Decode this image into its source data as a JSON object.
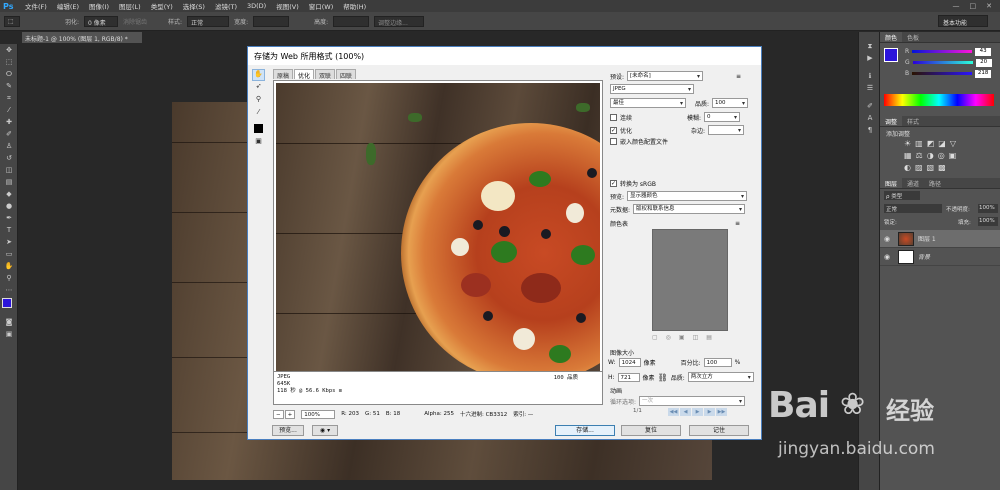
{
  "app": {
    "logo": "Ps",
    "menus": [
      "文件(F)",
      "编辑(E)",
      "图像(I)",
      "图层(L)",
      "类型(Y)",
      "选择(S)",
      "滤镜(T)",
      "3D(D)",
      "视图(V)",
      "窗口(W)",
      "帮助(H)"
    ],
    "window_controls": [
      "—",
      "□",
      "✕"
    ]
  },
  "options": {
    "feather_label": "羽化:",
    "feather_value": "0 像素",
    "antialias_label": "消除锯齿",
    "style_label": "样式:",
    "style_value": "正常",
    "width_label": "宽度:",
    "height_label": "高度:",
    "refine_edge": "调整边缘...",
    "workspace": "基本功能"
  },
  "document": {
    "tab": "未标题-1 @ 100% (图层 1, RGB/8) *"
  },
  "dialog": {
    "title": "存储为 Web 所用格式 (100%)",
    "tabs": [
      "原稿",
      "优化",
      "双联",
      "四联"
    ],
    "active_tab": "优化",
    "preview_info": {
      "format": "JPEG",
      "size": "645K",
      "time": "118 秒 @ 56.6 Kbps",
      "menu": "≡",
      "quality": "100 品质"
    },
    "status": {
      "zoom": "100%",
      "r": "R: 203",
      "g": "G: 51",
      "b": "B: 18",
      "alpha": "Alpha: 255",
      "hex": "十六进制: CB3312",
      "index": "索引: —"
    },
    "settings": {
      "preset_label": "预设:",
      "preset_value": "[未命名]",
      "format": "JPEG",
      "quality_level": "最佳",
      "quality_label": "品质:",
      "quality_value": "100",
      "progressive": "连续",
      "blur_label": "模糊:",
      "blur_value": "0",
      "optimized": "优化",
      "matte_label": "杂边:",
      "embed_profile": "嵌入颜色配置文件",
      "convert_srgb": "转换为 sRGB",
      "preview_label": "预览:",
      "preview_value": "显示器颜色",
      "metadata_label": "元数据:",
      "metadata_value": "版权和联系信息",
      "color_table": "颜色表",
      "image_size": "图像大小",
      "w_label": "W:",
      "w_value": "1024",
      "w_unit": "像素",
      "h_label": "H:",
      "h_value": "721",
      "h_unit": "像素",
      "percent_label": "百分比:",
      "percent_value": "100",
      "percent_unit": "%",
      "resample_label": "品质:",
      "resample_value": "两次立方",
      "animation": "动画",
      "loop_label": "循环选项:",
      "loop_value": "一次",
      "frame": "1/1"
    },
    "buttons": {
      "preview": "预览...",
      "save": "存储...",
      "reset": "复位",
      "remember": "记住"
    }
  },
  "right_panel": {
    "color_tabs": [
      "颜色",
      "色板"
    ],
    "r_label": "R",
    "r_value": "43",
    "g_label": "G",
    "g_value": "20",
    "b_label": "B",
    "b_value": "218",
    "adjust_tabs": [
      "调整",
      "样式"
    ],
    "add_adjustment": "添加调整",
    "layer_tabs": [
      "图层",
      "通道",
      "路径"
    ],
    "kind": "ρ 类型",
    "blend_mode": "正常",
    "opacity_label": "不透明度:",
    "opacity_value": "100%",
    "lock_label": "锁定:",
    "fill_label": "填充:",
    "fill_value": "100%",
    "layers": [
      {
        "name": "图层 1"
      },
      {
        "name": "背景"
      }
    ]
  },
  "watermark": {
    "brand": "Bai",
    "brand2": "经验",
    "url": "jingyan.baidu.com"
  },
  "colors": {
    "foreground": "#2b14da",
    "accent": "#31a8ff"
  }
}
